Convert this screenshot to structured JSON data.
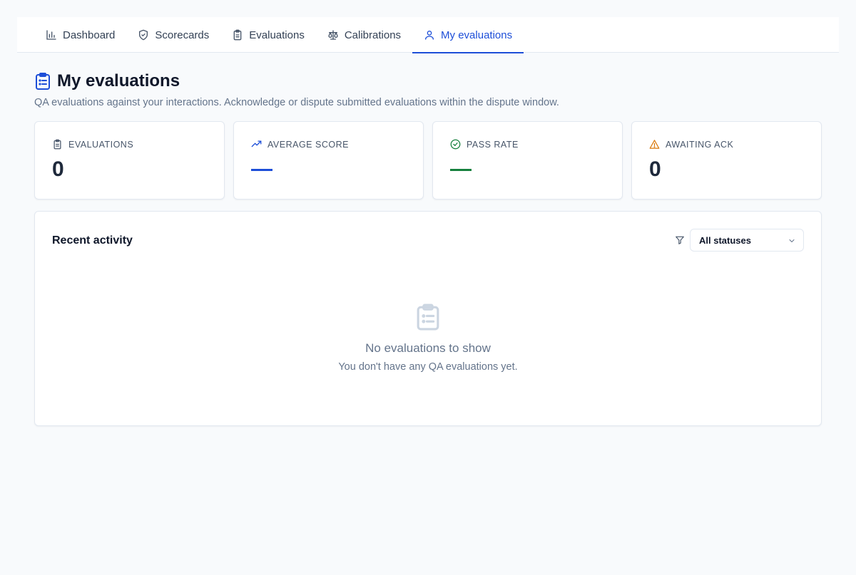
{
  "nav": {
    "tabs": [
      {
        "label": "Dashboard",
        "icon": "bar-chart-icon"
      },
      {
        "label": "Scorecards",
        "icon": "shield-check-icon"
      },
      {
        "label": "Evaluations",
        "icon": "clipboard-icon"
      },
      {
        "label": "Calibrations",
        "icon": "scale-icon"
      },
      {
        "label": "My evaluations",
        "icon": "user-icon",
        "active": true
      }
    ]
  },
  "page": {
    "title": "My evaluations",
    "subtitle": "QA evaluations against your interactions. Acknowledge or dispute submitted evaluations within the dispute window."
  },
  "stats": [
    {
      "label": "EVALUATIONS",
      "value": "0",
      "icon": "clipboard-icon",
      "color": "#475569"
    },
    {
      "label": "AVERAGE SCORE",
      "value": "—",
      "icon": "trending-up-icon",
      "color": "#1d4ed8"
    },
    {
      "label": "PASS RATE",
      "value": "—",
      "icon": "check-circle-icon",
      "color": "#15803d"
    },
    {
      "label": "AWAITING ACK",
      "value": "0",
      "icon": "alert-triangle-icon",
      "color": "#d97706"
    }
  ],
  "activity": {
    "title": "Recent activity",
    "filter_selected": "All statuses",
    "empty_title": "No evaluations to show",
    "empty_text": "You don't have any QA evaluations yet."
  },
  "colors": {
    "accent": "#1d4ed8",
    "success": "#15803d",
    "warning": "#d97706",
    "border": "#e2e8f0",
    "background": "#f8fafc"
  }
}
